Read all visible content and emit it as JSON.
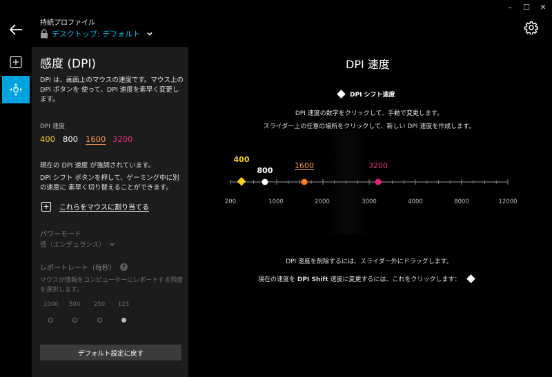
{
  "window": {
    "min": "–",
    "max": "☐",
    "close": "✕"
  },
  "header": {
    "persistent_label": "持続プロファイル",
    "profile_name": "デスクトップ: デフォルト"
  },
  "panel": {
    "title": "感度 (DPI)",
    "description": "DPI は、画面上のマウスの速度です。マウス上の DPI ボタンを 使って、DPI 速度を素早く変更します。",
    "dpi_label": "DPI 速度",
    "dpi_values": [
      "400",
      "800",
      "1600",
      "3200"
    ],
    "note_current": "現在の DPI 速度 が強調されています。",
    "note_shift": "DPI シフト ボタンを押して、ゲーミング中に別の速度に 素早く切り替えることができます。",
    "assign_label": "これらをマウスに割り当てる",
    "power_mode_label": "パワーモード",
    "power_mode_value": "低（エンデュランス）",
    "report_rate_label": "レポートレート（毎秒）",
    "report_rate_help": "?",
    "report_rate_desc": "マウスが情報をコンピューターにレポートする頻度を選択します。",
    "report_rates": [
      "1000",
      "500",
      "250",
      "125"
    ],
    "report_rate_selected": "125",
    "reset_label": "デフォルト設定に戻す"
  },
  "main": {
    "title": "DPI 速度",
    "shift_label": "DPI シフト速度",
    "instruction1": "DPI 速度の数字をクリックして、手動で変更します。",
    "instruction2": "スライダー上の任意の場所をクリックして、新しい DPI 速度を作成します。",
    "footer1": "DPI 速度を削除するには、スライダー外にドラッグします。",
    "footer2_prefix": "現在の速度を",
    "footer2_bold": "DPI Shift",
    "footer2_suffix": "速度に変更するには、これをクリックします："
  },
  "slider": {
    "scale_labels": [
      "200",
      "1000",
      "2000",
      "3000",
      "4000",
      "8000",
      "12000"
    ],
    "points": [
      {
        "value": "400",
        "color": "#f6d11f",
        "shape": "diamond"
      },
      {
        "value": "800",
        "color": "#ffffff",
        "shape": "circle"
      },
      {
        "value": "1600",
        "color": "#ff7a1a",
        "shape": "circle",
        "current": true
      },
      {
        "value": "3200",
        "color": "#e5207a",
        "shape": "circle"
      }
    ]
  },
  "colors": {
    "accent": "#00a3dd",
    "dpi_400": "#f6d11f",
    "dpi_1600": "#ff9a56",
    "dpi_3200": "#e7327f"
  },
  "icons": {
    "back": "arrow-left-icon",
    "lock": "lock-icon",
    "gear": "gear-icon",
    "add": "plus-square-icon",
    "dpi": "mouse-move-icon"
  }
}
